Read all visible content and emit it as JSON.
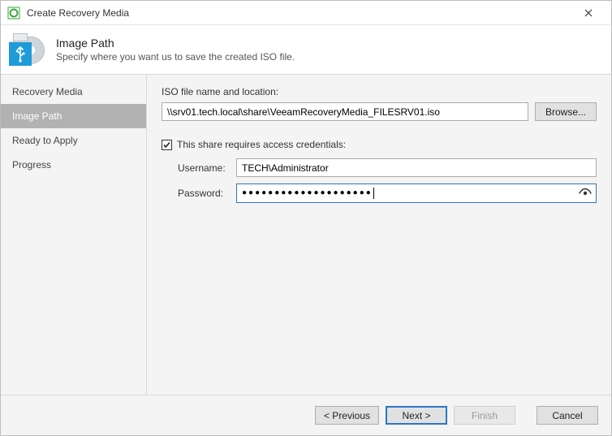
{
  "window": {
    "title": "Create Recovery Media"
  },
  "header": {
    "title": "Image Path",
    "subtitle": "Specify where you want us to save the created ISO file."
  },
  "sidebar": {
    "items": [
      {
        "label": "Recovery Media",
        "active": false
      },
      {
        "label": "Image Path",
        "active": true
      },
      {
        "label": "Ready to Apply",
        "active": false
      },
      {
        "label": "Progress",
        "active": false
      }
    ]
  },
  "content": {
    "iso_label": "ISO file name and location:",
    "iso_path": "\\\\srv01.tech.local\\share\\VeeamRecoveryMedia_FILESRV01.iso",
    "browse_label": "Browse...",
    "credentials": {
      "checkbox_label": "This share requires access credentials:",
      "checked": true,
      "username_label": "Username:",
      "username_value": "TECH\\Administrator",
      "password_label": "Password:",
      "password_mask": "●●●●●●●●●●●●●●●●●●●●"
    }
  },
  "footer": {
    "previous": "< Previous",
    "next": "Next >",
    "finish": "Finish",
    "cancel": "Cancel"
  }
}
